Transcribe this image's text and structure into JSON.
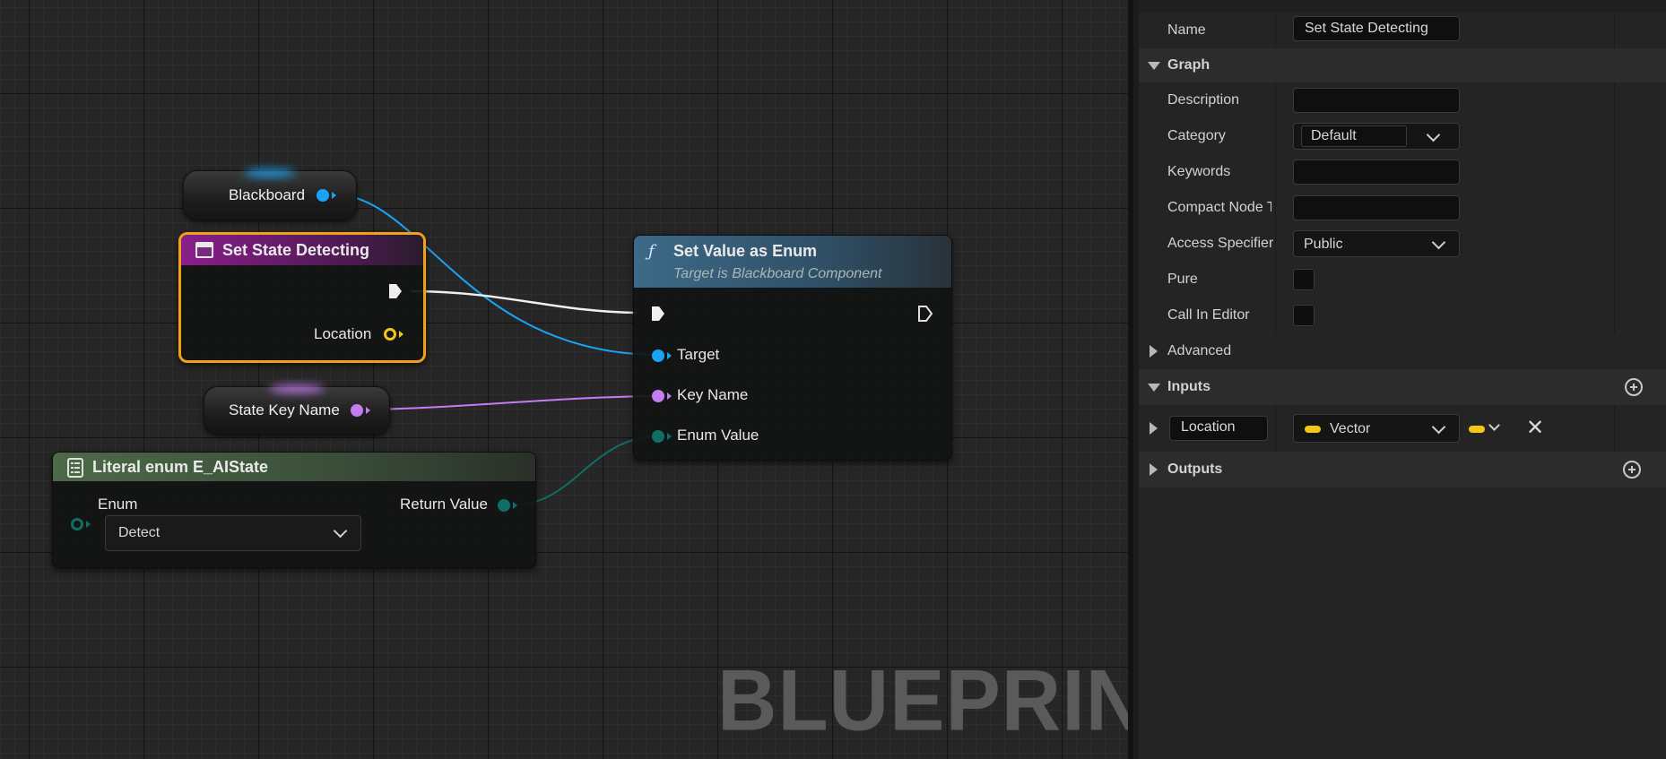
{
  "graph": {
    "watermark": "BLUEPRINT",
    "blackboard_node": {
      "label": "Blackboard"
    },
    "event_node": {
      "title": "Set State Detecting",
      "location_label": "Location"
    },
    "set_value_node": {
      "title": "Set Value as Enum",
      "subtitle": "Target is Blackboard Component",
      "target_label": "Target",
      "key_name_label": "Key Name",
      "enum_value_label": "Enum Value"
    },
    "state_key_node": {
      "label": "State Key Name"
    },
    "literal_node": {
      "title": "Literal enum E_AIState",
      "enum_label": "Enum",
      "return_label": "Return Value",
      "selected_value": "Detect"
    }
  },
  "details": {
    "name_label": "Name",
    "name_value": "Set State Detecting",
    "graph_section": "Graph",
    "description_label": "Description",
    "description_value": "",
    "category_label": "Category",
    "category_value": "Default",
    "keywords_label": "Keywords",
    "keywords_value": "",
    "compact_label": "Compact Node T",
    "compact_value": "",
    "access_label": "Access Specifier",
    "access_value": "Public",
    "pure_label": "Pure",
    "pure_checked": false,
    "call_in_editor_label": "Call In Editor",
    "call_in_editor_checked": false,
    "advanced_label": "Advanced",
    "inputs_section": "Inputs",
    "input_name": "Location",
    "input_type": "Vector",
    "outputs_section": "Outputs"
  },
  "colors": {
    "object_pin": "#1aa3f5",
    "name_pin": "#c47cf2",
    "enum_pin": "#0f6e66",
    "vector_pin": "#f5c518",
    "exec_wire": "#f0f0f0",
    "event_header": "#8a1e8c",
    "function_header": "#3d6a88",
    "literal_header": "#4d6a48",
    "selection_border": "#f0a11a"
  }
}
